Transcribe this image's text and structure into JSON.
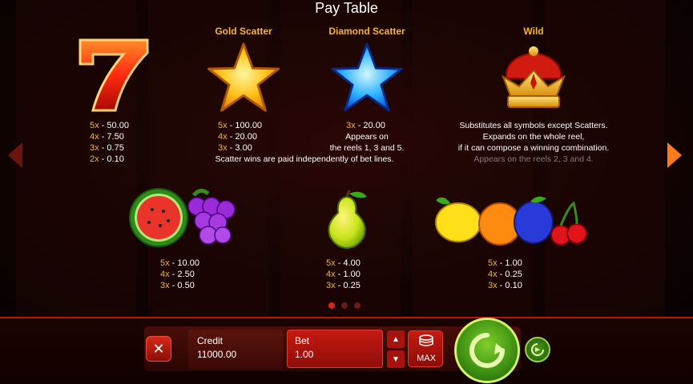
{
  "title": "Pay Table",
  "symbols_top": {
    "seven": {
      "pays": [
        [
          "5x",
          "50.00"
        ],
        [
          "4x",
          "7.50"
        ],
        [
          "3x",
          "0.75"
        ],
        [
          "2x",
          "0.10"
        ]
      ]
    },
    "gold_scatter": {
      "name": "Gold Scatter",
      "pays": [
        [
          "5x",
          "100.00"
        ],
        [
          "4x",
          "20.00"
        ],
        [
          "3x",
          "3.00"
        ]
      ],
      "note": "Scatter wins are paid independently of bet lines."
    },
    "diamond_scatter": {
      "name": "Diamond Scatter",
      "pays": [
        [
          "3x",
          "20.00"
        ]
      ],
      "note1": "Appears on",
      "note2": "the reels 1, 3 and 5."
    },
    "wild": {
      "name": "Wild",
      "line1": "Substitutes all symbols except Scatters.",
      "line2": "Expands on the whole reel,",
      "line3": "if it can compose a winning combination.",
      "line4": "Appears on the reels 2, 3 and 4."
    }
  },
  "symbols_bottom": {
    "melon_grape": {
      "pays": [
        [
          "5x",
          "10.00"
        ],
        [
          "4x",
          "2.50"
        ],
        [
          "3x",
          "0.50"
        ]
      ]
    },
    "pear": {
      "pays": [
        [
          "5x",
          "4.00"
        ],
        [
          "4x",
          "1.00"
        ],
        [
          "3x",
          "0.25"
        ]
      ]
    },
    "fruits": {
      "pays": [
        [
          "5x",
          "1.00"
        ],
        [
          "4x",
          "0.25"
        ],
        [
          "3x",
          "0.10"
        ]
      ]
    }
  },
  "controls": {
    "credit_label": "Credit",
    "credit_value": "11000.00",
    "bet_label": "Bet",
    "bet_value": "1.00",
    "max_label": "MAX",
    "close_glyph": "✕",
    "up_glyph": "▲",
    "down_glyph": "▼"
  },
  "pager": {
    "pages": 3,
    "active": 0
  },
  "icons": [
    "seven-icon",
    "gold-star-icon",
    "diamond-star-icon",
    "crown-icon",
    "watermelon-icon",
    "grapes-icon",
    "pear-icon",
    "lemon-icon",
    "orange-icon",
    "plum-icon",
    "cherry-icon",
    "coins-icon",
    "spin-icon",
    "autoplay-icon"
  ],
  "colors": {
    "accent": "#f5b53b",
    "note": "#8a7a78",
    "spin": "#3d8f12",
    "bet": "#c51a12"
  }
}
